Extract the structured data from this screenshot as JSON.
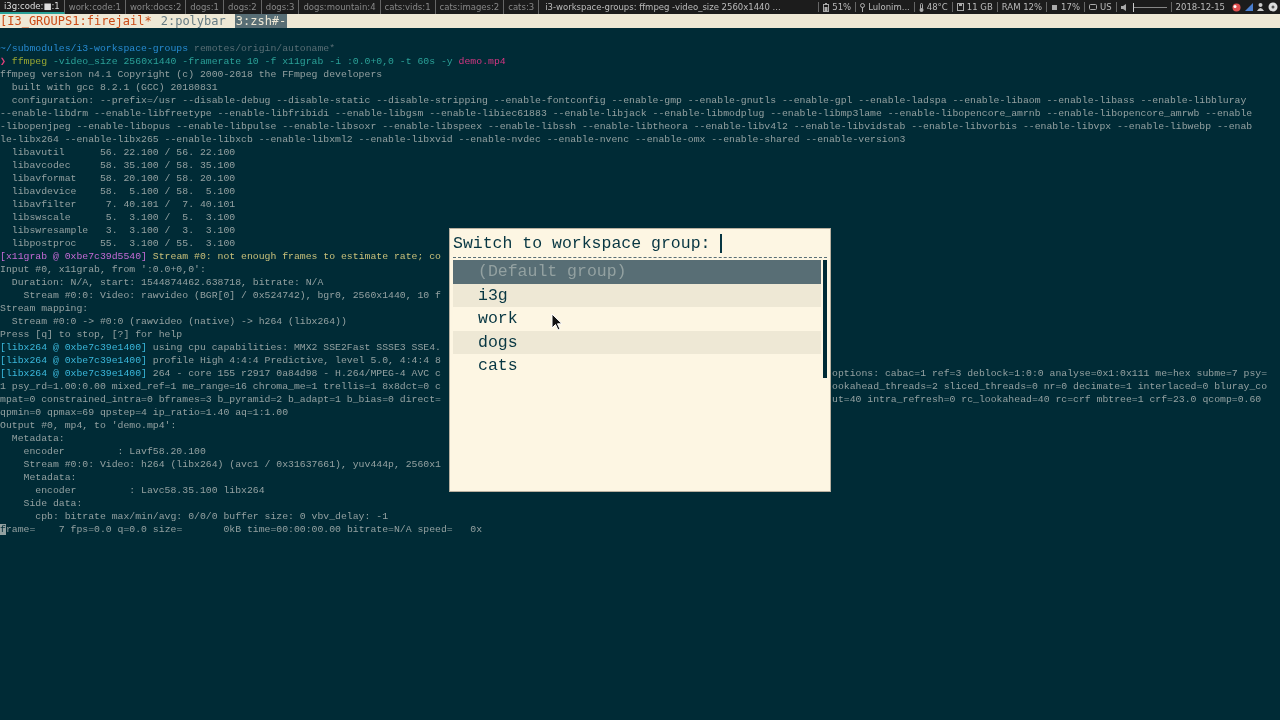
{
  "top_bar": {
    "workspaces": [
      {
        "label": "i3g:code:■:1",
        "selected": true
      },
      {
        "label": "work:code:1",
        "selected": false
      },
      {
        "label": "work:docs:2",
        "selected": false
      },
      {
        "label": "dogs:1",
        "selected": false
      },
      {
        "label": "dogs:2",
        "selected": false
      },
      {
        "label": "dogs:3",
        "selected": false
      },
      {
        "label": "dogs:mountain:4",
        "selected": false
      },
      {
        "label": "cats:vids:1",
        "selected": false
      },
      {
        "label": "cats:images:2",
        "selected": false
      },
      {
        "label": "cats:3",
        "selected": false
      }
    ],
    "window_title": "i3-workspace-groups: ffmpeg -video_size 2560x1440 ...",
    "status": [
      {
        "kind": "battery",
        "text": "51%"
      },
      {
        "kind": "wifi",
        "text": "Lulonim..."
      },
      {
        "kind": "temperature",
        "text": "48°C"
      },
      {
        "kind": "disk",
        "text": "11 GB"
      },
      {
        "kind": "text",
        "text": "RAM 12%"
      },
      {
        "kind": "cpu",
        "text": "17%"
      },
      {
        "kind": "keyboard",
        "text": "US"
      },
      {
        "kind": "volume",
        "level": 0
      },
      {
        "kind": "text",
        "text": "2018-12-15"
      }
    ]
  },
  "tmux_bar": {
    "left_label": "[I3_GROUPS1:firejail*",
    "windows": [
      {
        "label": "2:polybar",
        "selected": false
      },
      {
        "label": "3:zsh#-",
        "selected": true
      }
    ]
  },
  "terminal": {
    "lines": [
      {
        "spans": [
          {
            "kind": "path",
            "text": "~/submodules/i3-workspace-groups"
          },
          {
            "kind": "dim",
            "text": " remotes/origin/autoname*"
          }
        ]
      },
      {
        "spans": [
          {
            "kind": "prompt",
            "text": "❯ "
          },
          {
            "kind": "command",
            "text": "ffmpeg"
          },
          {
            "kind": "arg",
            "text": " -video_size 2560x1440 -framerate 10 -f x11grab -i :0.0+0,0 -t 60s -y "
          },
          {
            "kind": "file",
            "text": "demo.mp4"
          }
        ]
      },
      {
        "spans": [
          {
            "kind": "plain",
            "text": "ffmpeg version n4.1 Copyright (c) 2000-2018 the FFmpeg developers"
          }
        ]
      },
      {
        "spans": [
          {
            "kind": "plain",
            "text": "  built with gcc 8.2.1 (GCC) 20180831"
          }
        ]
      },
      {
        "spans": [
          {
            "kind": "plain",
            "text": "  configuration: --prefix=/usr --disable-debug --disable-static --disable-stripping --enable-fontconfig --enable-gmp --enable-gnutls --enable-gpl --enable-ladspa --enable-libaom --enable-libass --enable-libbluray"
          }
        ]
      },
      {
        "spans": [
          {
            "kind": "plain",
            "text": "--enable-libdrm --enable-libfreetype --enable-libfribidi --enable-libgsm --enable-libiec61883 --enable-libjack --enable-libmodplug --enable-libmp3lame --enable-libopencore_amrnb --enable-libopencore_amrwb --enable"
          }
        ]
      },
      {
        "spans": [
          {
            "kind": "plain",
            "text": "-libopenjpeg --enable-libopus --enable-libpulse --enable-libsoxr --enable-libspeex --enable-libssh --enable-libtheora --enable-libv4l2 --enable-libvidstab --enable-libvorbis --enable-libvpx --enable-libwebp --enab"
          }
        ]
      },
      {
        "spans": [
          {
            "kind": "plain",
            "text": "le-libx264 --enable-libx265 --enable-libxcb --enable-libxml2 --enable-libxvid --enable-nvdec --enable-nvenc --enable-omx --enable-shared --enable-version3"
          }
        ]
      },
      {
        "spans": [
          {
            "kind": "plain",
            "text": "  libavutil      56. 22.100 / 56. 22.100"
          }
        ]
      },
      {
        "spans": [
          {
            "kind": "plain",
            "text": "  libavcodec     58. 35.100 / 58. 35.100"
          }
        ]
      },
      {
        "spans": [
          {
            "kind": "plain",
            "text": "  libavformat    58. 20.100 / 58. 20.100"
          }
        ]
      },
      {
        "spans": [
          {
            "kind": "plain",
            "text": "  libavdevice    58.  5.100 / 58.  5.100"
          }
        ]
      },
      {
        "spans": [
          {
            "kind": "plain",
            "text": "  libavfilter     7. 40.101 /  7. 40.101"
          }
        ]
      },
      {
        "spans": [
          {
            "kind": "plain",
            "text": "  libswscale      5.  3.100 /  5.  3.100"
          }
        ]
      },
      {
        "spans": [
          {
            "kind": "plain",
            "text": "  libswresample   3.  3.100 /  3.  3.100"
          }
        ]
      },
      {
        "spans": [
          {
            "kind": "plain",
            "text": "  libpostproc    55.  3.100 / 55.  3.100"
          }
        ]
      },
      {
        "spans": [
          {
            "kind": "x11tag",
            "text": "[x11grab @ 0xbe7c39d5540]"
          },
          {
            "kind": "warn",
            "text": " Stream #0: not enough frames to estimate rate; co"
          }
        ]
      },
      {
        "spans": [
          {
            "kind": "plain",
            "text": "Input #0, x11grab, from ':0.0+0,0':"
          }
        ]
      },
      {
        "spans": [
          {
            "kind": "plain",
            "text": "  Duration: N/A, start: 1544874462.638718, bitrate: N/A"
          }
        ]
      },
      {
        "spans": [
          {
            "kind": "plain",
            "text": "    Stream #0:0: Video: rawvideo (BGR[0] / 0x524742), bgr0, 2560x1440, 10 f"
          }
        ]
      },
      {
        "spans": [
          {
            "kind": "plain",
            "text": "Stream mapping:"
          }
        ]
      },
      {
        "spans": [
          {
            "kind": "plain",
            "text": "  Stream #0:0 -> #0:0 (rawvideo (native) -> h264 (libx264))"
          }
        ]
      },
      {
        "spans": [
          {
            "kind": "plain",
            "text": "Press [q] to stop, [?] for help"
          }
        ]
      },
      {
        "spans": [
          {
            "kind": "x264tag",
            "text": "[libx264 @ 0xbe7c39e1400]"
          },
          {
            "kind": "plain",
            "text": " using cpu capabilities: MMX2 SSE2Fast SSSE3 SSE4."
          }
        ]
      },
      {
        "spans": [
          {
            "kind": "x264tag",
            "text": "[libx264 @ 0xbe7c39e1400]"
          },
          {
            "kind": "plain",
            "text": " profile High 4:4:4 Predictive, level 5.0, 4:4:4 8"
          }
        ]
      },
      {
        "spans": [
          {
            "kind": "x264tag",
            "text": "[libx264 @ 0xbe7c39e1400]"
          },
          {
            "kind": "plain",
            "text": " 264 - core 155 r2917 0a84d98 - H.264/MPEG-4 AVC c"
          }
        ],
        "after_popup": "options: cabac=1 ref=3 deblock=1:0:0 analyse=0x1:0x111 me=hex subme=7 psy="
      },
      {
        "spans": [
          {
            "kind": "plain",
            "text": "1 psy_rd=1.00:0.00 mixed_ref=1 me_range=16 chroma_me=1 trellis=1 8x8dct=0 c"
          }
        ],
        "after_popup": "ookahead_threads=2 sliced_threads=0 nr=0 decimate=1 interlaced=0 bluray_co"
      },
      {
        "spans": [
          {
            "kind": "plain",
            "text": "mpat=0 constrained_intra=0 bframes=3 b_pyramid=2 b_adapt=1 b_bias=0 direct="
          }
        ],
        "after_popup": "ut=40 intra_refresh=0 rc_lookahead=40 rc=crf mbtree=1 crf=23.0 qcomp=0.60"
      },
      {
        "spans": [
          {
            "kind": "plain",
            "text": "qpmin=0 qpmax=69 qpstep=4 ip_ratio=1.40 aq=1:1.00"
          }
        ]
      },
      {
        "spans": [
          {
            "kind": "plain",
            "text": "Output #0, mp4, to 'demo.mp4':"
          }
        ]
      },
      {
        "spans": [
          {
            "kind": "plain",
            "text": "  Metadata:"
          }
        ]
      },
      {
        "spans": [
          {
            "kind": "plain",
            "text": "    encoder         : Lavf58.20.100"
          }
        ]
      },
      {
        "spans": [
          {
            "kind": "plain",
            "text": "    Stream #0:0: Video: h264 (libx264) (avc1 / 0x31637661), yuv444p, 2560x1"
          }
        ]
      },
      {
        "spans": [
          {
            "kind": "plain",
            "text": "    Metadata:"
          }
        ]
      },
      {
        "spans": [
          {
            "kind": "plain",
            "text": "      encoder         : Lavc58.35.100 libx264"
          }
        ]
      },
      {
        "spans": [
          {
            "kind": "plain",
            "text": "    Side data:"
          }
        ]
      },
      {
        "spans": [
          {
            "kind": "plain",
            "text": "      cpb: bitrate max/min/avg: 0/0/0 buffer size: 0 vbv_delay: -1"
          }
        ]
      },
      {
        "spans": [
          {
            "kind": "plain",
            "text": "frame=    7 fps=0.0 q=0.0 size=       0kB time=00:00:00.00 bitrate=N/A speed=   0x"
          }
        ],
        "cursor": true
      }
    ]
  },
  "popup": {
    "prompt": "Switch to workspace group:",
    "entries": [
      {
        "label": "(Default group)",
        "selected": true
      },
      {
        "label": "i3g",
        "selected": false
      },
      {
        "label": "work",
        "selected": false
      },
      {
        "label": "dogs",
        "selected": false
      },
      {
        "label": "cats",
        "selected": false
      }
    ]
  }
}
